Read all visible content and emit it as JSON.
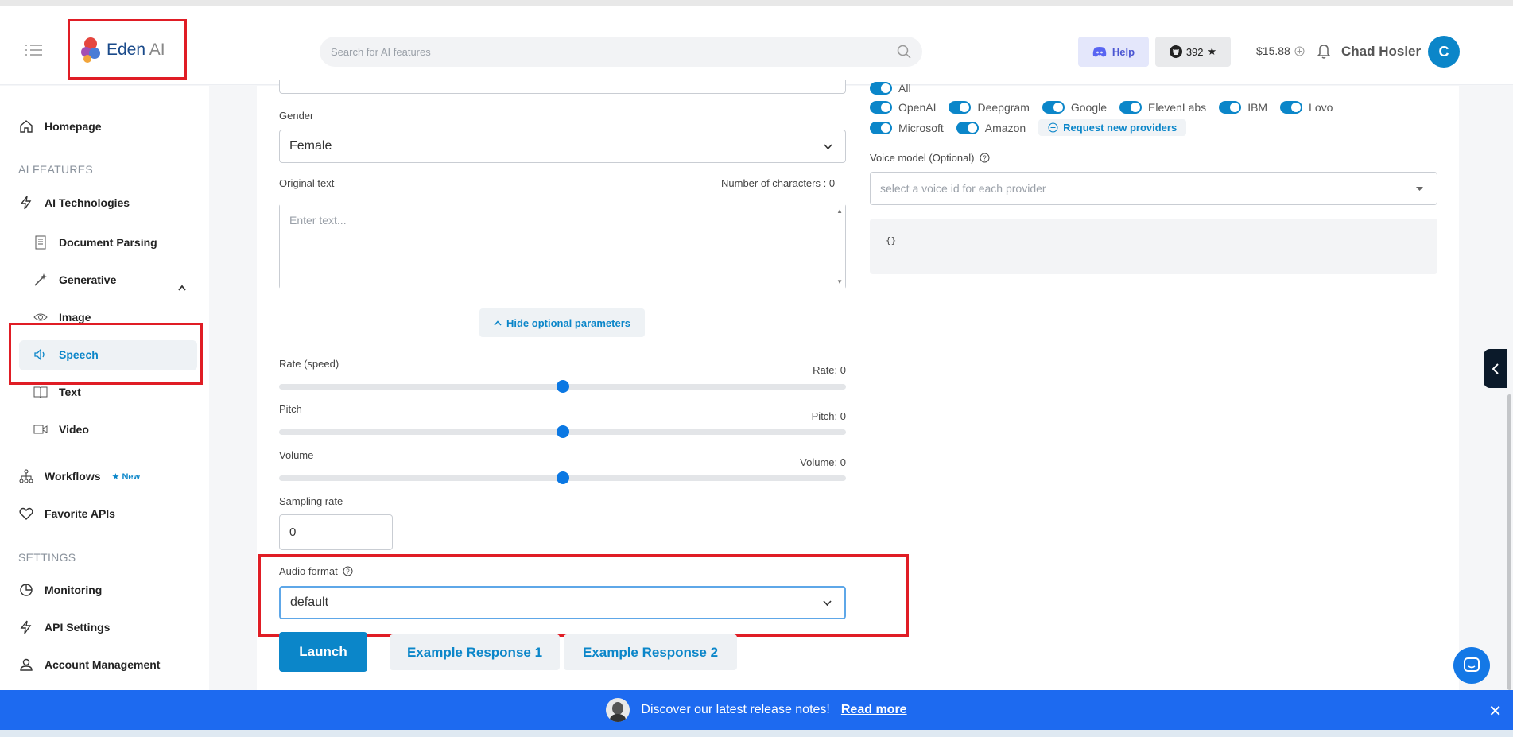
{
  "brand": {
    "logo_text_main": "Eden",
    "logo_text_ai": " AI"
  },
  "search": {
    "placeholder": "Search for AI features"
  },
  "header": {
    "help_label": "Help",
    "github_count": "392",
    "credits": "$15.88",
    "user_name": "Chad Hosler",
    "avatar_initial": "C"
  },
  "sidebar": {
    "homepage": "Homepage",
    "section_features": "AI FEATURES",
    "ai_technologies": "AI Technologies",
    "sub_items": [
      "Document Parsing",
      "Generative",
      "Image",
      "Speech",
      "Text",
      "Video"
    ],
    "workflows": "Workflows",
    "workflows_badge": "New",
    "favorite_apis": "Favorite APIs",
    "section_settings": "SETTINGS",
    "monitoring": "Monitoring",
    "api_settings": "API Settings",
    "account_management": "Account Management"
  },
  "form": {
    "gender_label": "Gender",
    "gender_value": "Female",
    "original_text_label": "Original text",
    "char_count": "Number of characters : 0",
    "text_placeholder": "Enter text...",
    "hide_params": "Hide optional parameters",
    "rate_label": "Rate (speed)",
    "rate_value": "Rate: 0",
    "rate_fraction": 0.5,
    "pitch_label": "Pitch",
    "pitch_value": "Pitch: 0",
    "pitch_fraction": 0.5,
    "volume_label": "Volume",
    "volume_value": "Volume: 0",
    "volume_fraction": 0.5,
    "sampling_label": "Sampling rate",
    "sampling_value": "0",
    "audio_format_label": "Audio format",
    "audio_format_value": "default",
    "launch": "Launch",
    "example1": "Example Response 1",
    "example2": "Example Response 2"
  },
  "providers": {
    "all": "All",
    "row1": [
      "OpenAI",
      "Deepgram",
      "Google",
      "ElevenLabs",
      "IBM",
      "Lovo"
    ],
    "row2": [
      "Microsoft",
      "Amazon"
    ],
    "request_new": "Request new providers",
    "voice_model_label": "Voice model (Optional)",
    "voice_placeholder": "select a voice id for each provider",
    "code": "{}"
  },
  "banner": {
    "message": "Discover our latest release notes!",
    "link": "Read more"
  },
  "colors": {
    "accent": "#0b86c9",
    "banner": "#1d6af0",
    "highlight": "#e01d25",
    "slider": "#0b78e3"
  }
}
